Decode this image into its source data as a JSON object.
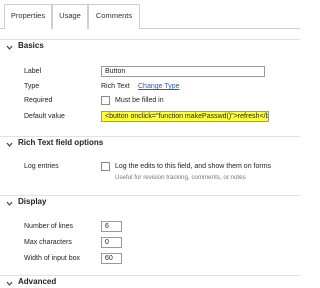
{
  "tabs": [
    {
      "label": "Properties",
      "active": true
    },
    {
      "label": "Usage",
      "active": false
    },
    {
      "label": "Comments",
      "active": false
    }
  ],
  "sections": {
    "basics": {
      "title": "Basics",
      "label_label": "Label",
      "label_value": "Button",
      "type_label": "Type",
      "type_value": "Rich Text",
      "change_type_link": "Change Type",
      "required_label": "Required",
      "required_checkbox_label": "Must be filled in",
      "required_checked": false,
      "default_value_label": "Default value",
      "default_value": "<button onclick=\"function makePasswd()\">refresh</bu"
    },
    "rich_text_options": {
      "title": "Rich Text field options",
      "log_entries_label": "Log entries",
      "log_checkbox_label": "Log the edits to this field, and show them on forms",
      "log_hint": "Useful for revision tracking, comments, or notes",
      "log_checked": false
    },
    "display": {
      "title": "Display",
      "lines_label": "Number of lines",
      "lines_value": "6",
      "max_chars_label": "Max characters",
      "max_chars_value": "0",
      "width_label": "Width of input box",
      "width_value": "60"
    },
    "advanced": {
      "title": "Advanced"
    }
  },
  "icons": {
    "section_chevron": "chevron-down-icon"
  },
  "colors": {
    "highlight": "#ffff3a",
    "link": "#2a5db0"
  }
}
